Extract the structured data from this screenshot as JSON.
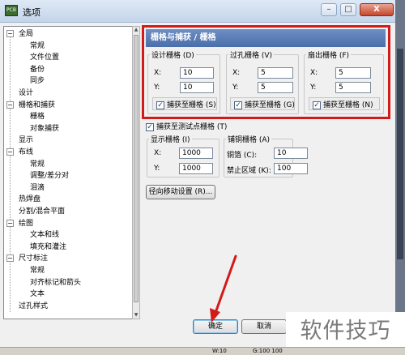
{
  "window": {
    "title": "选项",
    "app_icon_text": "PCB",
    "min_label": "–",
    "max_label": "□",
    "close_label": "X"
  },
  "tree": {
    "items": [
      {
        "label": "全局",
        "expander": "⊟"
      },
      {
        "label": "常规"
      },
      {
        "label": "文件位置"
      },
      {
        "label": "备份"
      },
      {
        "label": "同步"
      },
      {
        "label": "设计"
      },
      {
        "label": "栅格和捕获",
        "expander": "⊟"
      },
      {
        "label": "栅格"
      },
      {
        "label": "对象捕获"
      },
      {
        "label": "显示"
      },
      {
        "label": "布线",
        "expander": "⊟"
      },
      {
        "label": "常规"
      },
      {
        "label": "调整/差分对"
      },
      {
        "label": "泪滴"
      },
      {
        "label": "热焊盘"
      },
      {
        "label": "分割/混合平面"
      },
      {
        "label": "绘图",
        "expander": "⊟"
      },
      {
        "label": "文本和线"
      },
      {
        "label": "填充和灌注"
      },
      {
        "label": "尺寸标注",
        "expander": "⊟"
      },
      {
        "label": "常规"
      },
      {
        "label": "对齐标记和箭头"
      },
      {
        "label": "文本"
      },
      {
        "label": "过孔样式"
      }
    ]
  },
  "panel": {
    "header": "栅格与捕获 / 栅格",
    "design_grid": {
      "title": "设计栅格 (D)",
      "x_label": "X:",
      "x_value": "10",
      "y_label": "Y:",
      "y_value": "10",
      "snap_label": "捕获至栅格 (S)"
    },
    "via_grid": {
      "title": "过孔栅格 (V)",
      "x_label": "X:",
      "x_value": "5",
      "y_label": "Y:",
      "y_value": "5",
      "snap_label": "捕获至栅格 (G)"
    },
    "fanout_grid": {
      "title": "扇出栅格 (F)",
      "x_label": "X:",
      "x_value": "5",
      "y_label": "Y:",
      "y_value": "5",
      "snap_label": "捕获至栅格 (N)"
    },
    "snap_test_point": "捕获至测试点栅格 (T)",
    "display_grid": {
      "title": "显示栅格 (I)",
      "x_label": "X:",
      "x_value": "1000",
      "y_label": "Y:",
      "y_value": "1000"
    },
    "copper_grid": {
      "title": "铺铜栅格 (A)",
      "copper_label": "铜箔 (C):",
      "copper_value": "10",
      "keepout_label": "禁止区域 (K):",
      "keepout_value": "100"
    },
    "radial_button": "径向移动设置 (R)...",
    "checkmark": "✓"
  },
  "buttons": {
    "ok": "确定",
    "cancel": "取消"
  },
  "status": {
    "w": "W:10",
    "g": "G:100 100"
  },
  "watermark": "软件技巧",
  "colors": {
    "highlight": "#d31a1a",
    "arrow": "#d31a1a"
  }
}
